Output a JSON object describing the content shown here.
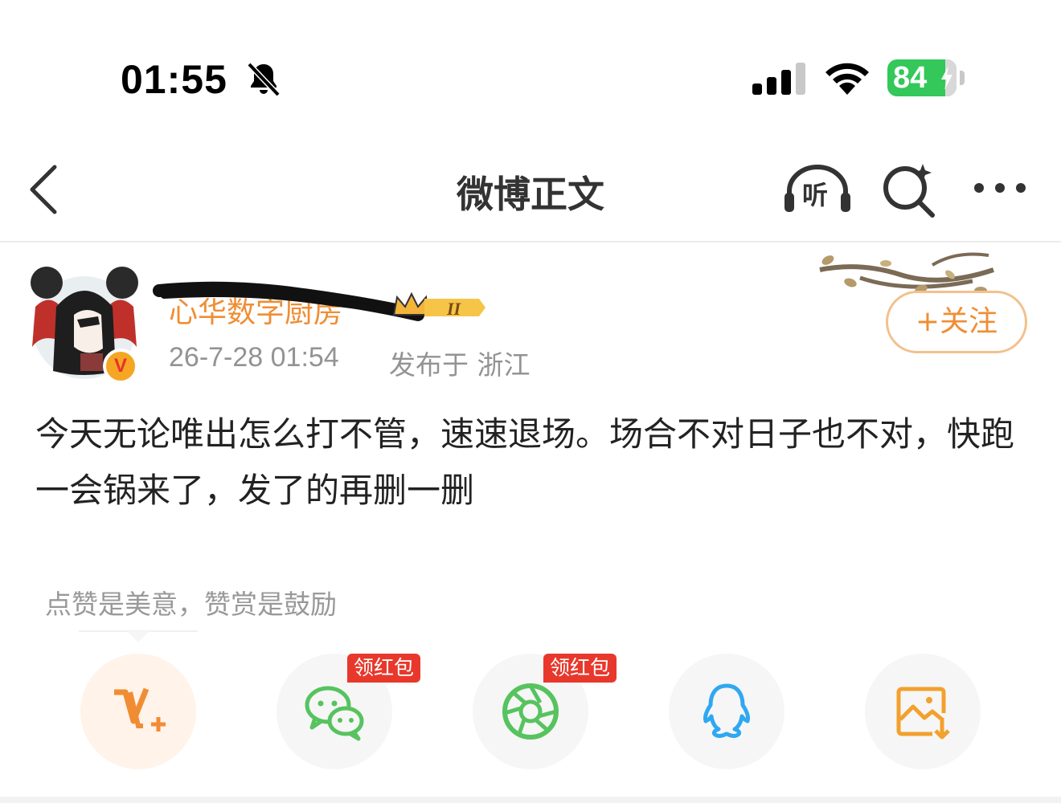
{
  "status_bar": {
    "time": "01:55",
    "battery_percent": "84",
    "icons": [
      "bell-muted-icon",
      "cellular-signal-icon",
      "wifi-icon",
      "battery-charging-icon"
    ]
  },
  "nav": {
    "title": "微博正文",
    "listen_label": "听",
    "icons": [
      "back-icon",
      "listen-icon",
      "ai-search-icon",
      "more-icon"
    ]
  },
  "post": {
    "author_name": "心华数字厨房",
    "verified_badge": "V",
    "level_badge": "II",
    "timestamp": "26-7-28 01:54",
    "published_from": "发布于 浙江",
    "follow_label": "+关注",
    "text": "今天无论唯出怎么打不管，速速退场。场合不对日子也不对，快跑一会锅来了，发了的再删一删"
  },
  "reward_hint": "点赞是美意，赞赏是鼓励",
  "share": {
    "buttons": [
      {
        "icon": "reward-v-plus-icon",
        "tag": ""
      },
      {
        "icon": "wechat-icon",
        "tag": "领红包"
      },
      {
        "icon": "moments-icon",
        "tag": "领红包"
      },
      {
        "icon": "qq-icon",
        "tag": ""
      },
      {
        "icon": "save-image-icon",
        "tag": ""
      }
    ]
  },
  "colors": {
    "accent_orange": "#f08d33",
    "battery_green": "#34c759",
    "red_tag": "#e8382c",
    "wechat_green": "#57c35f",
    "qq_blue": "#2fa8f0"
  }
}
